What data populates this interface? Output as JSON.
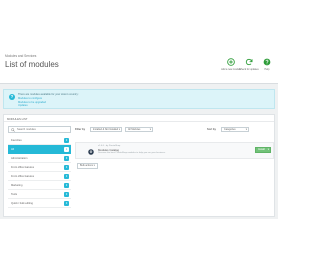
{
  "header": {
    "breadcrumb": "Modules and Services",
    "title": "List of modules",
    "actions": [
      {
        "label": "Add a new module",
        "icon": "plus-circle-icon"
      },
      {
        "label": "Check for updates",
        "icon": "refresh-icon"
      },
      {
        "label": "Help",
        "icon": "help-icon"
      }
    ]
  },
  "info": {
    "text": "There are modules available for your store's country:",
    "links": [
      "Modules to configure",
      "Modules to be upgraded",
      "Updates"
    ]
  },
  "section": {
    "title": "MODULES LIST",
    "search": {
      "placeholder": "Search modules",
      "value": ""
    },
    "categories": [
      {
        "label": "Favorites",
        "count": "0",
        "active": false
      },
      {
        "label": "All",
        "count": "1",
        "active": true
      },
      {
        "label": "Administration",
        "count": "0",
        "active": false
      },
      {
        "label": "Front office features",
        "count": "0",
        "active": false
      },
      {
        "label": "Front office features",
        "count": "0",
        "active": false
      },
      {
        "label": "Marketing",
        "count": "0",
        "active": false
      },
      {
        "label": "Tools",
        "count": "0",
        "active": false
      },
      {
        "label": "Quick / bulk editing",
        "count": "0",
        "active": false
      }
    ],
    "filters": {
      "filter_by_label": "Filter by",
      "select1": "Installed & Not Installed",
      "select2": "All Modules",
      "sort_label": "Sort by",
      "select3": "Categories"
    },
    "module": {
      "meta": "v1.0.0 - by PrestaShop",
      "name": "Modules Catalog",
      "description": "Discover the best PrestaShop modules to help you run your business.",
      "install_label": "Install"
    },
    "more_label": "Bulk actions"
  },
  "colors": {
    "accent": "#25b9d7",
    "install": "#72c279",
    "info_bg": "#dcf4f9"
  }
}
